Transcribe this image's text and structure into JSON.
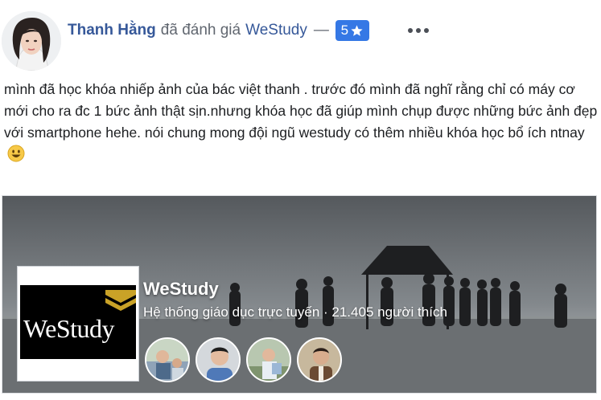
{
  "post": {
    "author": "Thanh Hằng",
    "verb": "đã đánh giá",
    "page": "WeStudy",
    "dash": "—",
    "rating": "5",
    "body": "mình đã học khóa nhiếp ảnh của bác việt thanh . trước đó mình đã nghĩ rằng chỉ có máy cơ mới cho ra đc 1 bức ảnh thật sịn.nhưng khóa học đã giúp mình chụp được những bức ảnh đẹp với smartphone hehe. nói chung mong đội ngũ westudy có thêm nhiều khóa học bổ ích ntnay"
  },
  "card": {
    "page_name": "WeStudy",
    "subtitle": "Hệ thống giáo dục trực tuyến · 21.405 người thích",
    "logo_text": "WeStudy"
  },
  "icons": {
    "star": "star-icon",
    "more": "more-dots-icon",
    "emoji": "smile-emoji-icon"
  },
  "colors": {
    "link": "#365899",
    "rating_badge": "#3578e5",
    "logo_bg": "#000000",
    "logo_accent": "#c9a227"
  }
}
